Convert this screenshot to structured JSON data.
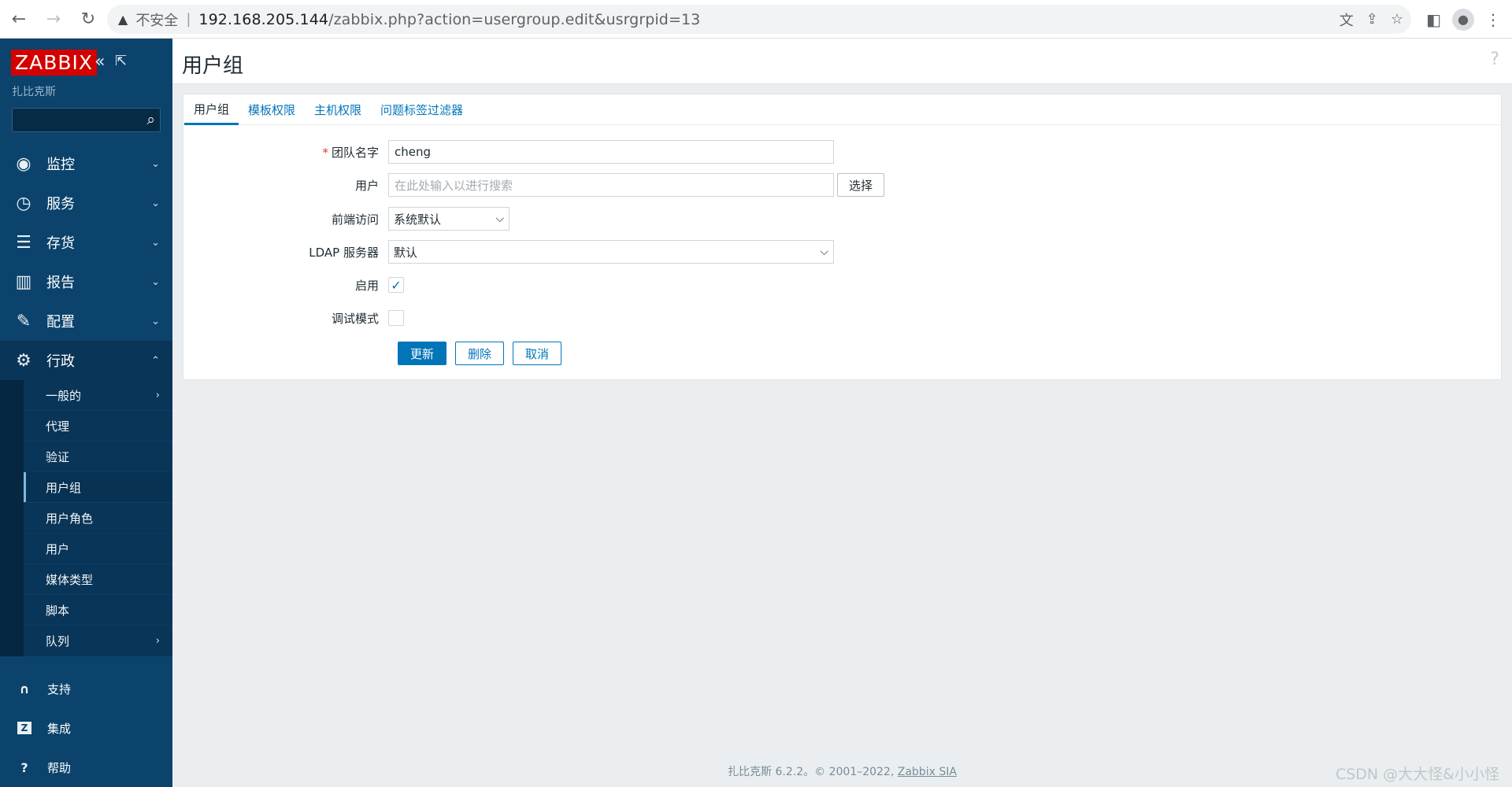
{
  "browser": {
    "warning_icon": "warning-triangle-icon",
    "insecure_label": "不安全",
    "separator": "|",
    "url_host": "192.168.205.144",
    "url_rest": "/zabbix.php?action=usergroup.edit&usrgrpid=13"
  },
  "sidebar": {
    "brand": "ZABBIX",
    "server_name": "扎比克斯",
    "menu": [
      {
        "label": "监控",
        "icon": "eye-icon"
      },
      {
        "label": "服务",
        "icon": "clock-icon"
      },
      {
        "label": "存货",
        "icon": "list-icon"
      },
      {
        "label": "报告",
        "icon": "chart-icon"
      },
      {
        "label": "配置",
        "icon": "wrench-icon"
      },
      {
        "label": "行政",
        "icon": "gear-icon"
      }
    ],
    "submenu": [
      {
        "label": "一般的"
      },
      {
        "label": "代理"
      },
      {
        "label": "验证"
      },
      {
        "label": "用户组"
      },
      {
        "label": "用户角色"
      },
      {
        "label": "用户"
      },
      {
        "label": "媒体类型"
      },
      {
        "label": "脚本"
      },
      {
        "label": "队列"
      }
    ],
    "bottom": [
      {
        "label": "支持",
        "icon": "headset-icon"
      },
      {
        "label": "集成",
        "icon": "z-icon"
      },
      {
        "label": "帮助",
        "icon": "question-icon"
      }
    ]
  },
  "header": {
    "title": "用户组",
    "help": "?"
  },
  "tabs": [
    {
      "label": "用户组"
    },
    {
      "label": "模板权限"
    },
    {
      "label": "主机权限"
    },
    {
      "label": "问题标签过滤器"
    }
  ],
  "form": {
    "group_name_label": "团队名字",
    "required_mark": "*",
    "group_name_value": "cheng",
    "users_label": "用户",
    "users_placeholder": "在此处输入以进行搜索",
    "select_button": "选择",
    "frontend_label": "前端访问",
    "frontend_value": "系统默认",
    "ldap_label": "LDAP 服务器",
    "ldap_value": "默认",
    "enabled_label": "启用",
    "enabled_checked": true,
    "debug_label": "调试模式",
    "debug_checked": false,
    "update_button": "更新",
    "delete_button": "删除",
    "cancel_button": "取消"
  },
  "footer": {
    "text": "扎比克斯 6.2.2。© 2001–2022, ",
    "link": "Zabbix SIA"
  },
  "watermark": "CSDN @大大怪&小小怪",
  "colors": {
    "sidebar_bg": "#0b436c",
    "brand_red": "#d40000",
    "primary_blue": "#0275b8",
    "page_bg": "#ebeef0"
  }
}
